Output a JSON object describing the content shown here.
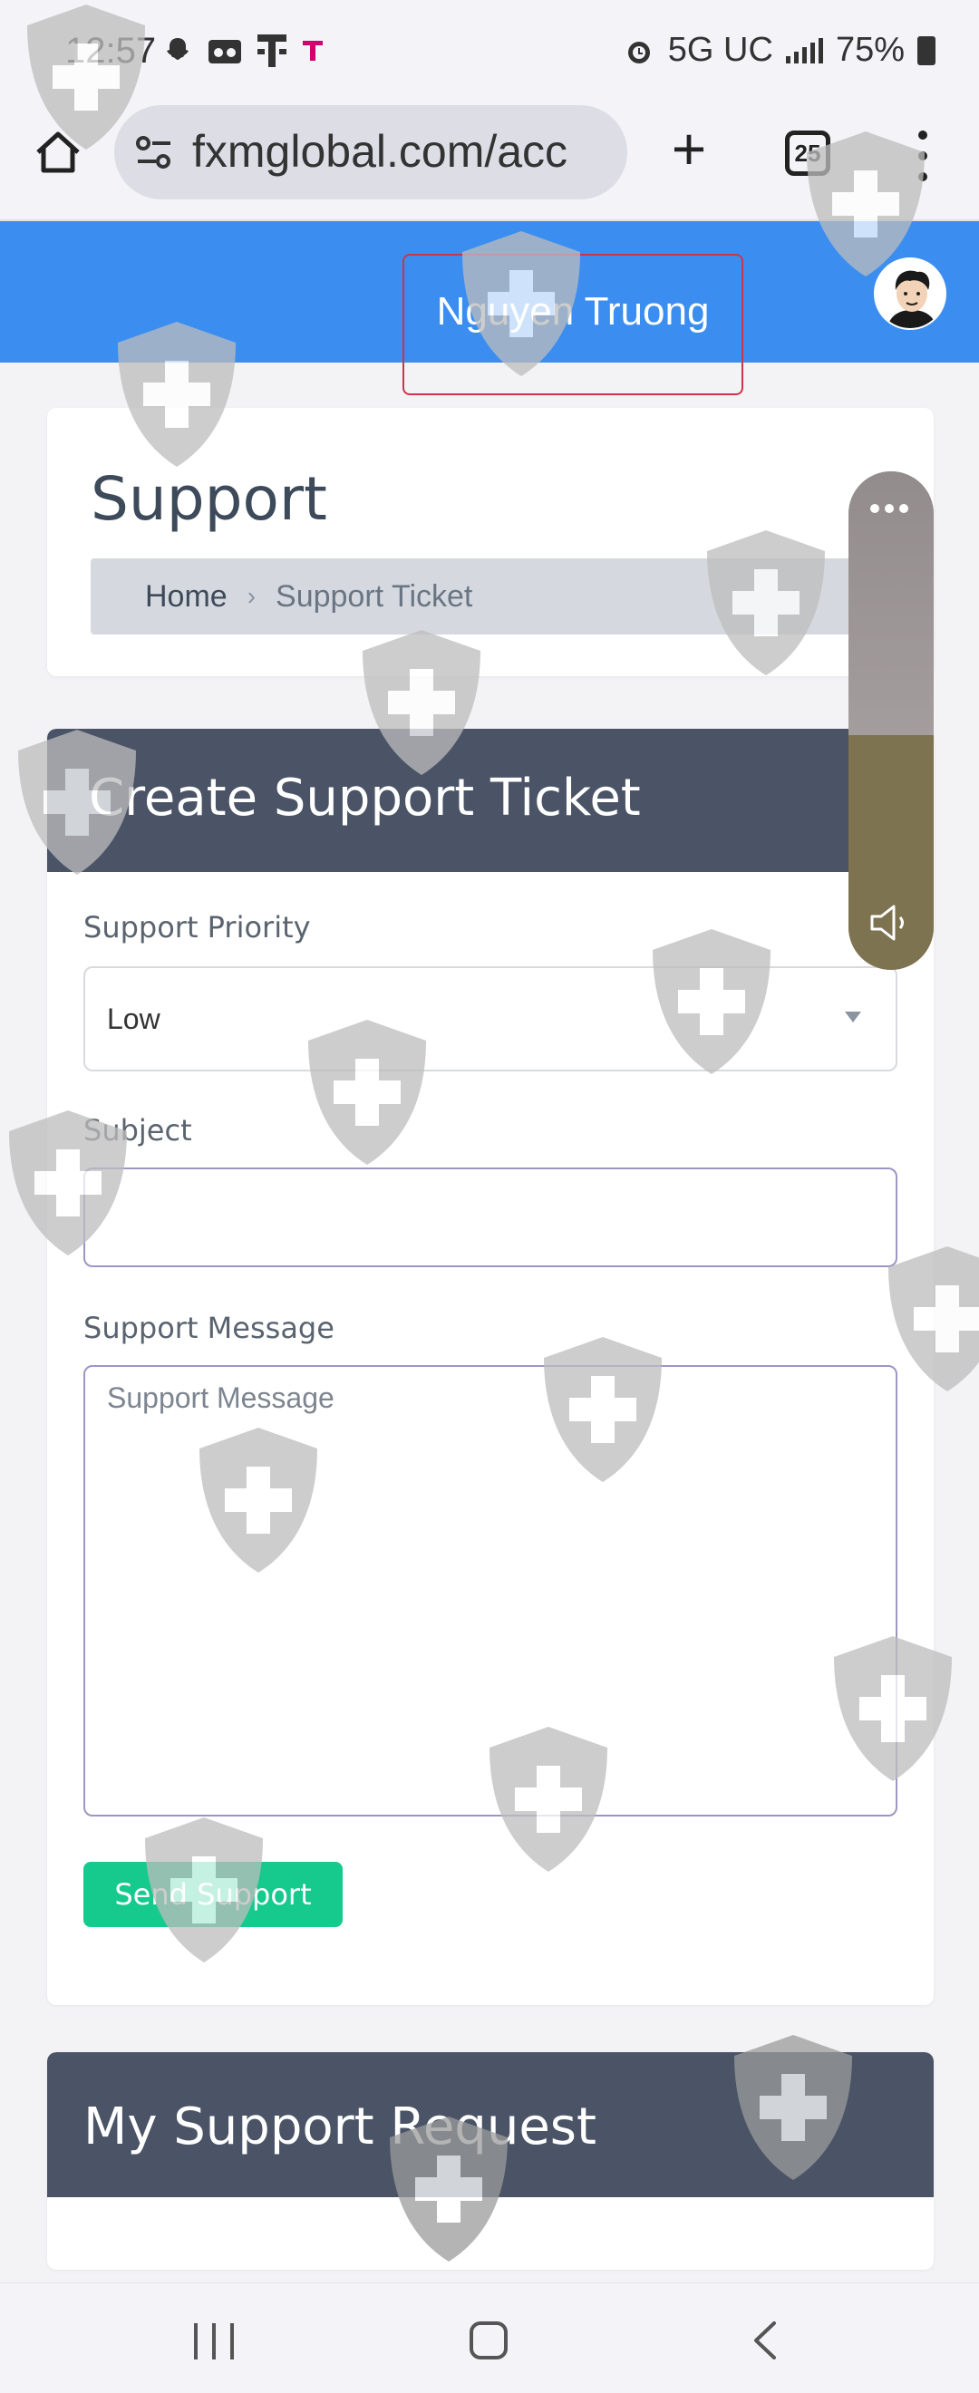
{
  "status_bar": {
    "time": "12:57",
    "network": "5G UC",
    "battery": "75%",
    "left_icons": [
      "snapchat-icon",
      "voicemail-icon",
      "tmobile-icon",
      "tmobile-small-icon"
    ],
    "right_icons": [
      "alarm-icon",
      "signal-icon",
      "battery-icon"
    ]
  },
  "browser": {
    "url": "fxmglobal.com/acc",
    "tab_count": "25"
  },
  "header": {
    "menu_glyph": "",
    "user_name": "Nguyen Truong"
  },
  "support_card": {
    "title": "Support",
    "breadcrumb_home_glyph": "",
    "breadcrumb": {
      "home": "Home",
      "separator": "›",
      "current": "Support Ticket"
    }
  },
  "create_ticket": {
    "title_glyph": "",
    "title": "Create Support Ticket",
    "priority_label": "Support Priority",
    "priority_value": "Low",
    "subject_label": "Subject",
    "subject_value": "",
    "message_label": "Support Message",
    "message_placeholder": "Support Message",
    "send_glyph": "",
    "send_label": "Send Support"
  },
  "my_requests": {
    "title": "My Support Request",
    "tool_glyphs": [
      "",
      ""
    ]
  },
  "colors": {
    "header_blue": "#3b8ef0",
    "card_header": "#4a5466",
    "send_green": "#16c98c",
    "volume_fill": "#7d7350"
  },
  "volume_level": 0.47
}
